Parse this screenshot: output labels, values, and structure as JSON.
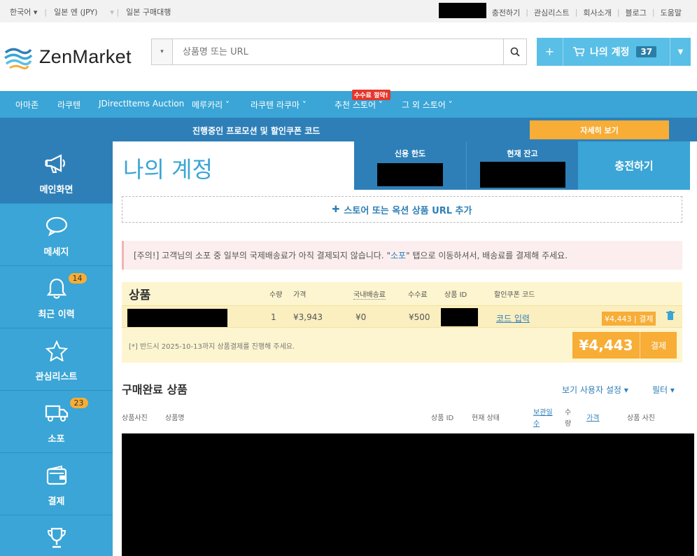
{
  "topbar": {
    "language": "한국어",
    "currency": "일본 엔 (JPY)",
    "service": "일본 구매대행",
    "links": [
      "충전하기",
      "관심리스트",
      "회사소개",
      "블로그",
      "도움말"
    ]
  },
  "header": {
    "logo_text": "ZenMarket",
    "search_placeholder": "상품명 또는 URL",
    "account_label": "나의 계정",
    "account_count": "37",
    "plus": "+"
  },
  "nav": {
    "items": [
      "아마존",
      "라쿠텐",
      "JDirectItems Auction",
      "메루카리",
      "라쿠텐 라쿠마",
      "추천 스토어",
      "그 외 스토어"
    ],
    "hot_badge": "수수료 절약!"
  },
  "promo": {
    "text": "진행중인 프로모션 및 할인쿠폰 코드",
    "button": "자세히 보기"
  },
  "sidebar": {
    "items": [
      {
        "label": "메인화면",
        "icon": "megaphone-icon"
      },
      {
        "label": "메세지",
        "icon": "chat-icon"
      },
      {
        "label": "최근 이력",
        "icon": "bell-icon",
        "badge": "14"
      },
      {
        "label": "관심리스트",
        "icon": "star-icon"
      },
      {
        "label": "소포",
        "icon": "truck-icon",
        "badge": "23"
      },
      {
        "label": "결제",
        "icon": "wallet-icon"
      },
      {
        "label": "",
        "icon": "trophy-icon"
      }
    ]
  },
  "main": {
    "title": "나의 계정",
    "credit_limit_label": "신용 한도",
    "balance_label": "현재 잔고",
    "charge_button": "충전하기",
    "add_url": "스토어 또는 옥션 상품 URL 추가",
    "notice_prefix": "[주의!] 고객님의 소포 중 일부의 국제배송료가 아직 결제되지 않습니다. \"",
    "notice_link": "소포",
    "notice_suffix": "\" 탭으로 이동하셔서, 배송료를 결제해 주세요."
  },
  "cart": {
    "title": "상품",
    "headers": {
      "qty": "수량",
      "price": "가격",
      "domestic": "국내배송료",
      "fee": "수수료",
      "item_id": "상품 ID",
      "coupon": "할인쿠폰 코드"
    },
    "row": {
      "qty": "1",
      "price": "¥3,943",
      "domestic": "¥0",
      "fee": "¥500",
      "coupon_link": "코드 입력",
      "total": "¥4,443",
      "pay": "결제"
    },
    "footer_note": "[*] 반드시 2025-10-13까지 상품결제를 진행해 주세요.",
    "grand_total": "¥4,443",
    "pay_button": "결제"
  },
  "completed": {
    "title": "구매완료 상품",
    "view_settings": "보기 사용자 설정",
    "filter": "필터",
    "columns": {
      "photo": "상품사진",
      "name": "상품명",
      "item_id": "상품 ID",
      "status": "현재 상태",
      "storage_a": "보관일",
      "storage_b": "수",
      "qty_a": "수",
      "qty_b": "량",
      "price": "가격",
      "photo2": "상품 사진"
    }
  },
  "colors": {
    "primary": "#3aa5d6",
    "dark": "#2e7fb8",
    "accent": "#f7ad36"
  }
}
